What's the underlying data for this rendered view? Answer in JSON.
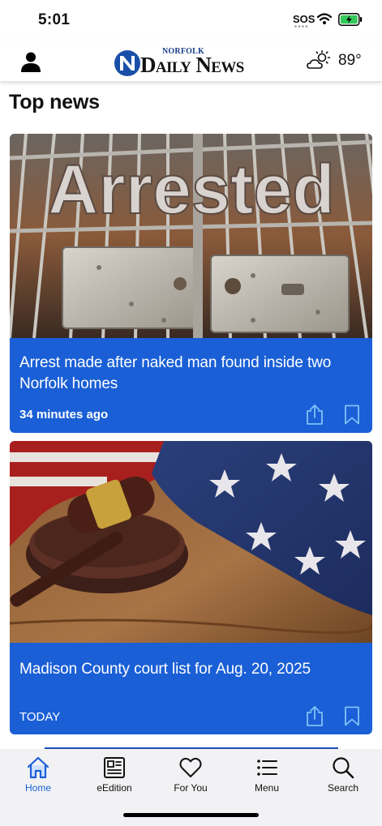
{
  "status_bar": {
    "time": "5:01",
    "sos": "SOS"
  },
  "header": {
    "logo_small": "NORFOLK",
    "logo_main": "Daily News",
    "temperature": "89°",
    "weather_icon": "partly-sunny-icon"
  },
  "section": {
    "title": "Top news"
  },
  "articles": [
    {
      "headline": "Arrest made after naked man found inside two Norfolk homes",
      "image_text": "Arrested",
      "time": "34 minutes ago"
    },
    {
      "headline": "Madison County court list for Aug. 20, 2025",
      "time": "TODAY"
    }
  ],
  "bottom_nav": {
    "active": "Home",
    "items": [
      {
        "label": "Home",
        "icon": "home-icon"
      },
      {
        "label": "eEdition",
        "icon": "newspaper-icon"
      },
      {
        "label": "For You",
        "icon": "heart-icon"
      },
      {
        "label": "Menu",
        "icon": "list-icon"
      },
      {
        "label": "Search",
        "icon": "search-icon"
      }
    ]
  },
  "colors": {
    "accent": "#1a5fd6",
    "card_blue": "#1a5fd6",
    "battery_green": "#34c759"
  }
}
